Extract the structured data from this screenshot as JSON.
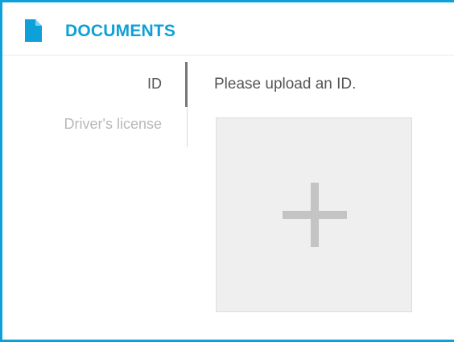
{
  "header": {
    "title": "DOCUMENTS",
    "icon": "document-icon"
  },
  "tabs": [
    {
      "label": "ID",
      "active": true
    },
    {
      "label": "Driver's license",
      "active": false
    }
  ],
  "content": {
    "title": "Please upload an ID.",
    "upload_icon": "plus-icon"
  },
  "colors": {
    "accent": "#0ea0d8",
    "text": "#555555",
    "muted": "#b8b8b8",
    "upload_bg": "#efefef",
    "plus": "#c4c4c4"
  }
}
